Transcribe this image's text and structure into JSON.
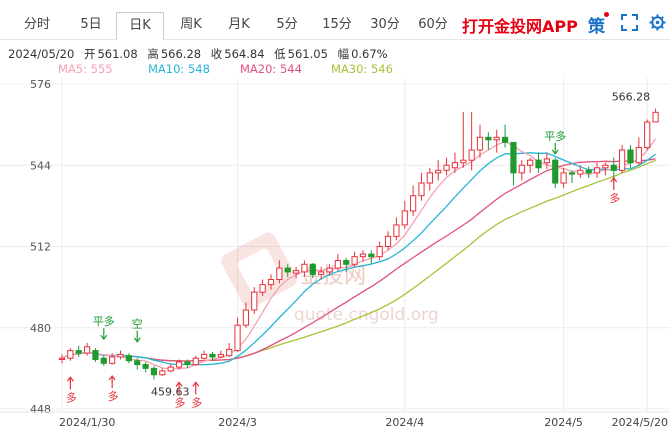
{
  "tabs": [
    {
      "label": "分时",
      "active": false
    },
    {
      "label": "5日",
      "active": false
    },
    {
      "label": "日K",
      "active": true
    },
    {
      "label": "周K",
      "active": false
    },
    {
      "label": "月K",
      "active": false
    },
    {
      "label": "5分",
      "active": false
    },
    {
      "label": "15分",
      "active": false
    },
    {
      "label": "30分",
      "active": false
    },
    {
      "label": "60分",
      "active": false
    }
  ],
  "brand": "打开金投网APP",
  "tools": {
    "strategy_label": "策",
    "fullscreen_icon": "fullscreen-icon",
    "settings_icon": "gear-icon"
  },
  "info": {
    "date": "2024/05/20",
    "open_label": "开",
    "open": "561.08",
    "high_label": "高",
    "high": "566.28",
    "close_label": "收",
    "close": "564.84",
    "low_label": "低",
    "low": "561.05",
    "amp_label": "幅",
    "amp": "0.67%"
  },
  "ma_labels": [
    {
      "text": "MA5: 555",
      "color": "#f4a0b4"
    },
    {
      "text": "MA10: 548",
      "color": "#27b5d6"
    },
    {
      "text": "MA20: 544",
      "color": "#e0527d"
    },
    {
      "text": "MA30: 546",
      "color": "#a8c23a"
    }
  ],
  "watermark": {
    "line1": "金投网",
    "line2": "quote.cngold.org"
  },
  "chart_data": {
    "type": "candlestick",
    "y_ticks": [
      "576",
      "544",
      "512",
      "480",
      "448"
    ],
    "ylim": [
      448,
      576
    ],
    "x_ticks": [
      {
        "label": "2024/1/30",
        "index": 0
      },
      {
        "label": "2024/3",
        "index": 21
      },
      {
        "label": "2024/4",
        "index": 41
      },
      {
        "label": "2024/5",
        "index": 60
      },
      {
        "label": "2024/5/20",
        "index": 70
      }
    ],
    "markers": {
      "max_label": "566.28",
      "max_index": 70,
      "max_value": 566.28,
      "min_label": "459.63",
      "min_index": 11,
      "min_value": 459.63
    },
    "annotations": [
      {
        "text": "平多",
        "index": 5,
        "value": 475.5,
        "dir": "down"
      },
      {
        "text": "空",
        "index": 9,
        "value": 474.5,
        "dir": "down"
      },
      {
        "text": "多",
        "index": 1,
        "value": 460.5,
        "dir": "up"
      },
      {
        "text": "多",
        "index": 6,
        "value": 461,
        "dir": "up"
      },
      {
        "text": "多",
        "index": 14,
        "value": 458.5,
        "dir": "up"
      },
      {
        "text": "多",
        "index": 16,
        "value": 458.5,
        "dir": "up"
      },
      {
        "text": "平多",
        "index": 59,
        "value": 548.5,
        "dir": "down"
      },
      {
        "text": "多",
        "index": 66,
        "value": 539,
        "dir": "up"
      }
    ],
    "candles": [
      [
        467.5,
        468,
        469.5,
        466
      ],
      [
        468,
        471,
        472,
        467
      ],
      [
        471,
        470,
        473,
        468.5
      ],
      [
        470,
        472.5,
        474,
        469
      ],
      [
        471,
        467.5,
        472,
        466.5
      ],
      [
        468,
        466,
        469,
        465
      ],
      [
        466,
        468.5,
        470,
        465.5
      ],
      [
        468.5,
        469.5,
        471,
        467.5
      ],
      [
        469,
        467,
        470,
        466
      ],
      [
        467,
        465.5,
        468,
        463.5
      ],
      [
        465.5,
        464,
        466.5,
        462.5
      ],
      [
        464,
        461.5,
        465,
        459.63
      ],
      [
        461.5,
        463,
        464,
        461
      ],
      [
        463,
        464.5,
        466,
        462.5
      ],
      [
        464.5,
        466.5,
        467.5,
        463.5
      ],
      [
        466.5,
        465.5,
        467.5,
        464
      ],
      [
        465.5,
        468,
        469,
        465
      ],
      [
        468,
        469.5,
        471,
        467.5
      ],
      [
        469.5,
        468.5,
        470.5,
        467
      ],
      [
        468.5,
        469.5,
        471,
        468
      ],
      [
        469,
        471.5,
        474,
        468.5
      ],
      [
        471,
        481,
        484,
        470.5
      ],
      [
        481,
        487,
        490,
        480
      ],
      [
        487,
        494,
        496,
        485.5
      ],
      [
        494,
        497,
        499,
        492.5
      ],
      [
        497,
        499,
        501,
        495
      ],
      [
        499,
        503.5,
        506.5,
        497.5
      ],
      [
        503.5,
        502,
        505,
        500
      ],
      [
        501.5,
        502.5,
        504,
        499.5
      ],
      [
        502,
        505,
        506.5,
        500
      ],
      [
        505,
        501,
        505.5,
        499.5
      ],
      [
        501,
        502,
        504,
        499
      ],
      [
        502,
        503.5,
        505,
        500.5
      ],
      [
        503.5,
        506.5,
        509,
        502.5
      ],
      [
        506.5,
        505,
        507.5,
        502
      ],
      [
        505,
        508,
        510,
        504
      ],
      [
        508,
        509,
        510.5,
        506
      ],
      [
        509,
        508,
        510.5,
        505
      ],
      [
        508,
        512,
        514,
        506.5
      ],
      [
        512,
        516,
        518,
        510.5
      ],
      [
        516,
        520.5,
        523.5,
        514.5
      ],
      [
        520.5,
        526,
        530,
        519
      ],
      [
        526,
        532,
        536,
        524
      ],
      [
        532,
        537,
        541,
        530
      ],
      [
        537,
        541,
        543,
        534
      ],
      [
        541,
        542,
        546,
        538
      ],
      [
        542,
        544,
        547,
        540
      ],
      [
        543,
        545,
        549,
        541
      ],
      [
        545,
        546,
        565,
        543
      ],
      [
        546,
        550,
        565,
        542
      ],
      [
        550,
        555,
        560,
        547
      ],
      [
        555,
        554,
        557,
        550
      ],
      [
        554,
        555,
        558,
        549
      ],
      [
        555,
        553,
        560,
        551
      ],
      [
        553,
        541,
        545,
        536
      ],
      [
        541,
        544,
        546,
        538
      ],
      [
        544,
        546,
        547,
        541
      ],
      [
        546,
        543,
        549,
        541
      ],
      [
        545,
        546.5,
        549,
        542.5
      ],
      [
        546,
        537,
        547,
        535
      ],
      [
        537,
        541,
        543,
        535
      ],
      [
        541,
        540.5,
        542,
        537
      ],
      [
        540.5,
        542,
        544,
        539
      ],
      [
        542,
        541,
        543.5,
        539
      ],
      [
        541,
        543,
        545,
        539
      ],
      [
        543,
        544,
        545,
        540
      ],
      [
        544,
        542,
        547,
        537
      ],
      [
        542,
        550,
        552,
        541
      ],
      [
        550,
        545,
        552,
        543
      ],
      [
        545,
        551,
        555,
        544
      ],
      [
        551,
        561,
        562,
        550
      ],
      [
        561.08,
        564.84,
        566.28,
        561.05
      ]
    ]
  }
}
